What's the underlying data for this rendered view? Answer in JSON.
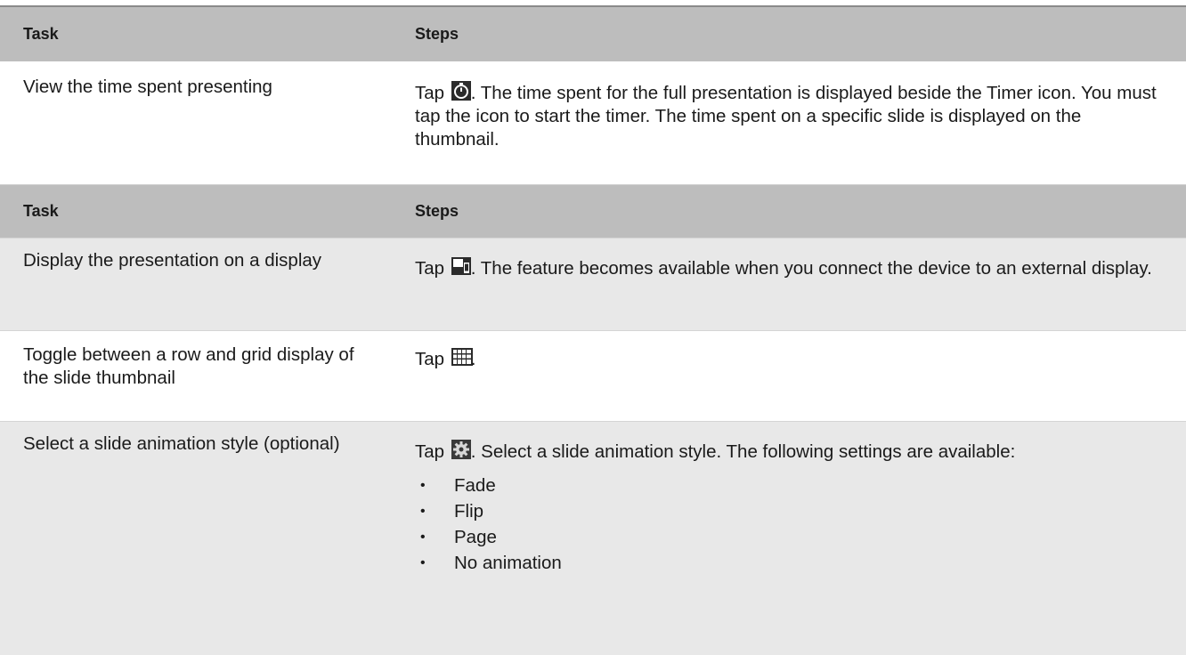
{
  "headers": {
    "task": "Task",
    "steps": "Steps"
  },
  "table1": {
    "rows": [
      {
        "task": "View the time spent presenting",
        "steps_prefix": "Tap",
        "icon": "timer-icon",
        "steps_text": ". The time spent for the full presentation is displayed beside the Timer icon. You must tap the icon to start the timer. The time spent on a specific slide is displayed on the thumbnail."
      }
    ]
  },
  "table2": {
    "rows": [
      {
        "task": "Display the presentation on a display",
        "steps_prefix": "Tap",
        "icon": "external-display-icon",
        "steps_text": ". The feature becomes available when you connect the device to an external display."
      },
      {
        "task": "Toggle between a row and grid display of the slide thumbnail",
        "steps_prefix": "Tap",
        "icon": "grid-view-icon",
        "steps_text": "."
      },
      {
        "task": "Select a slide animation style (optional)",
        "steps_prefix": "Tap",
        "icon": "settings-gear-icon",
        "steps_text": ". Select a slide animation style. The following settings are available:",
        "options": [
          "Fade",
          "Flip",
          "Page",
          "No animation"
        ]
      }
    ]
  },
  "colors": {
    "header_bg": "#bdbdbd",
    "shaded_row_bg": "#e8e8e8",
    "rule": "#8a8a8a"
  }
}
